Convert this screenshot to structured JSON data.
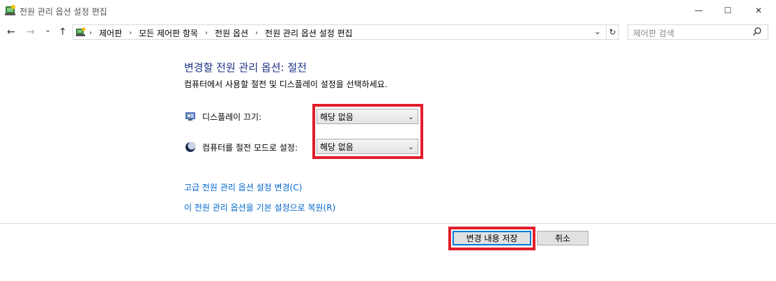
{
  "window": {
    "title": "전원 관리 옵션 설정 편집",
    "minimize_glyph": "—",
    "maximize_glyph": "☐",
    "close_glyph": "✕"
  },
  "nav": {
    "back_glyph": "←",
    "forward_glyph": "→",
    "recent_glyph": "⌄",
    "up_glyph": "↑"
  },
  "address": {
    "breadcrumbs": [
      "제어판",
      "모든 제어판 항목",
      "전원 옵션",
      "전원 관리 옵션 설정 편집"
    ],
    "separator": "›",
    "dropdown_glyph": "⌄",
    "refresh_glyph": "↻"
  },
  "search": {
    "placeholder": "제어판 검색"
  },
  "main": {
    "heading": "변경할 전원 관리 옵션: 절전",
    "description": "컴퓨터에서 사용할 절전 및 디스플레이 설정을 선택하세요.",
    "settings": [
      {
        "label": "디스플레이 끄기:",
        "value": "해당 없음",
        "icon": "display-icon"
      },
      {
        "label": "컴퓨터를 절전 모드로 설정:",
        "value": "해당 없음",
        "icon": "sleep-moon-icon"
      }
    ],
    "links": [
      "고급 전원 관리 옵션 설정 변경(C)",
      "이 전원 관리 옵션을 기본 설정으로 복원(R)"
    ]
  },
  "buttons": {
    "save": "변경 내용 저장",
    "cancel": "취소"
  },
  "colors": {
    "highlight": "#e21d2b",
    "heading": "#1e3287",
    "link": "#0066cc",
    "focus": "#0078d7"
  }
}
